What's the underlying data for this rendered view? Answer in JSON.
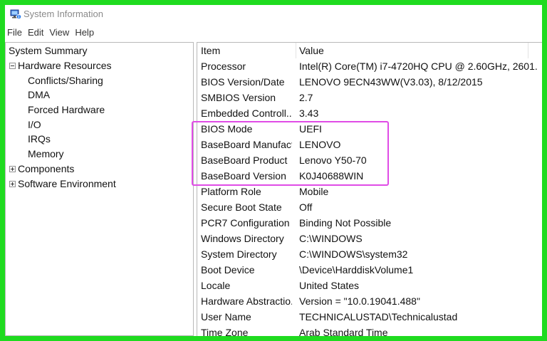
{
  "window": {
    "title": "System Information",
    "icon": "system-information-icon",
    "accent_border": "#1fdb1f",
    "highlight_color": "#e04ce6"
  },
  "menu": [
    "File",
    "Edit",
    "View",
    "Help"
  ],
  "tree": [
    {
      "label": "System Summary",
      "level": 0,
      "expander": "none"
    },
    {
      "label": "Hardware Resources",
      "level": 0,
      "expander": "minus"
    },
    {
      "label": "Conflicts/Sharing",
      "level": 1,
      "expander": "none"
    },
    {
      "label": "DMA",
      "level": 1,
      "expander": "none"
    },
    {
      "label": "Forced Hardware",
      "level": 1,
      "expander": "none"
    },
    {
      "label": "I/O",
      "level": 1,
      "expander": "none"
    },
    {
      "label": "IRQs",
      "level": 1,
      "expander": "none"
    },
    {
      "label": "Memory",
      "level": 1,
      "expander": "none"
    },
    {
      "label": "Components",
      "level": 0,
      "expander": "plus"
    },
    {
      "label": "Software Environment",
      "level": 0,
      "expander": "plus"
    }
  ],
  "table": {
    "headers": [
      "Item",
      "Value"
    ],
    "rows": [
      [
        "Processor",
        "Intel(R) Core(TM) i7-4720HQ CPU @ 2.60GHz, 2601..."
      ],
      [
        "BIOS Version/Date",
        "LENOVO 9ECN43WW(V3.03), 8/12/2015"
      ],
      [
        "SMBIOS Version",
        "2.7"
      ],
      [
        "Embedded Controll...",
        "3.43"
      ],
      [
        "BIOS Mode",
        "UEFI"
      ],
      [
        "BaseBoard Manufact...",
        "LENOVO"
      ],
      [
        "BaseBoard Product",
        "Lenovo Y50-70"
      ],
      [
        "BaseBoard Version",
        "K0J40688WIN"
      ],
      [
        "Platform Role",
        "Mobile"
      ],
      [
        "Secure Boot State",
        "Off"
      ],
      [
        "PCR7 Configuration",
        "Binding Not Possible"
      ],
      [
        "Windows Directory",
        "C:\\WINDOWS"
      ],
      [
        "System Directory",
        "C:\\WINDOWS\\system32"
      ],
      [
        "Boot Device",
        "\\Device\\HarddiskVolume1"
      ],
      [
        "Locale",
        "United States"
      ],
      [
        "Hardware Abstractio...",
        "Version = \"10.0.19041.488\""
      ],
      [
        "User Name",
        "TECHNICALUSTAD\\Technicalustad"
      ],
      [
        "Time Zone",
        "Arab Standard Time"
      ]
    ]
  }
}
